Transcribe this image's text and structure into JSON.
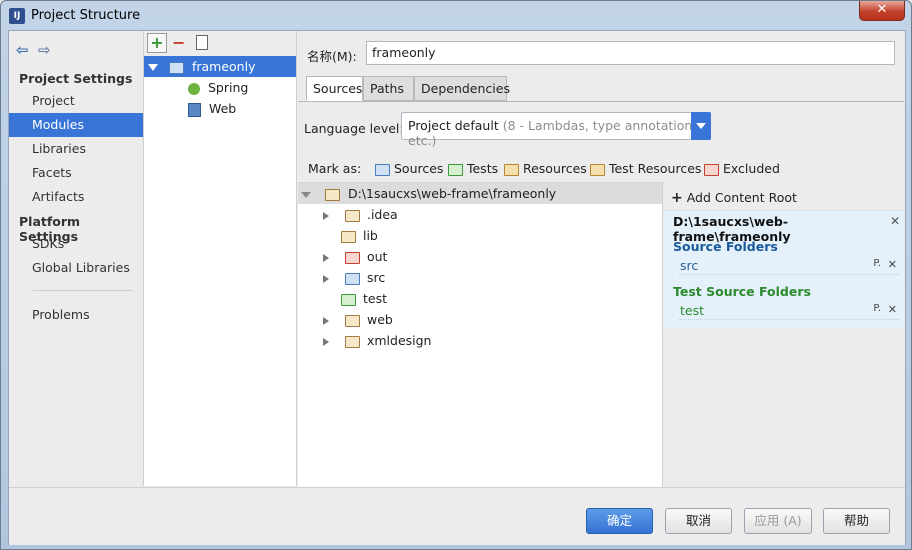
{
  "window": {
    "title": "Project Structure",
    "close_glyph": "✕",
    "app_icon_text": "IJ"
  },
  "nav": {
    "back_icon": "arrow-left-icon",
    "forward_icon": "arrow-right-icon",
    "project_settings_header": "Project Settings",
    "project_settings": [
      "Project",
      "Modules",
      "Libraries",
      "Facets",
      "Artifacts"
    ],
    "platform_settings_header": "Platform Settings",
    "platform_settings": [
      "SDKs",
      "Global Libraries"
    ],
    "problems": "Problems",
    "selected": "Modules"
  },
  "modules": {
    "toolbar": {
      "add": "+",
      "remove": "−",
      "copy_icon": "copy-icon"
    },
    "tree": [
      {
        "label": "frameonly",
        "icon": "module-folder-icon",
        "expanded": true,
        "selected": true
      },
      {
        "label": "Spring",
        "icon": "spring-icon"
      },
      {
        "label": "Web",
        "icon": "web-icon"
      }
    ]
  },
  "name_field": {
    "label": "名称(M):",
    "value": "frameonly"
  },
  "tabs": [
    "Sources",
    "Paths",
    "Dependencies"
  ],
  "active_tab": "Sources",
  "language_level": {
    "label": "Language level:",
    "value": "Project default",
    "hint": "(8 - Lambdas, type annotations etc.)"
  },
  "mark_as": {
    "label": "Mark as:",
    "items": [
      {
        "label": "Sources",
        "color": "#4a7cb8"
      },
      {
        "label": "Tests",
        "color": "#3c9a3c"
      },
      {
        "label": "Resources",
        "color": "#b8862e"
      },
      {
        "label": "Test Resources",
        "color": "#b8862e"
      },
      {
        "label": "Excluded",
        "color": "#c4412b"
      }
    ]
  },
  "file_tree": {
    "root": "D:\\1saucxs\\web-frame\\frameonly",
    "children": [
      {
        "label": ".idea",
        "expandable": true,
        "kind": "plain"
      },
      {
        "label": "lib",
        "expandable": false,
        "kind": "plain"
      },
      {
        "label": "out",
        "expandable": true,
        "kind": "red"
      },
      {
        "label": "src",
        "expandable": true,
        "kind": "blue"
      },
      {
        "label": "test",
        "expandable": false,
        "kind": "green"
      },
      {
        "label": "web",
        "expandable": true,
        "kind": "plain"
      },
      {
        "label": "xmldesign",
        "expandable": true,
        "kind": "plain"
      }
    ]
  },
  "content_roots": {
    "add_label": "Add Content Root",
    "root_path": "D:\\1saucxs\\web-frame\\frameonly",
    "source_folders_title": "Source Folders",
    "source_folders": [
      "src"
    ],
    "test_folders_title": "Test Source Folders",
    "test_folders": [
      "test"
    ],
    "entry_props_glyph": "P.",
    "entry_remove_glyph": "✕"
  },
  "buttons": {
    "ok": "确定",
    "cancel": "取消",
    "apply": "应用 (A)",
    "help": "帮助"
  }
}
